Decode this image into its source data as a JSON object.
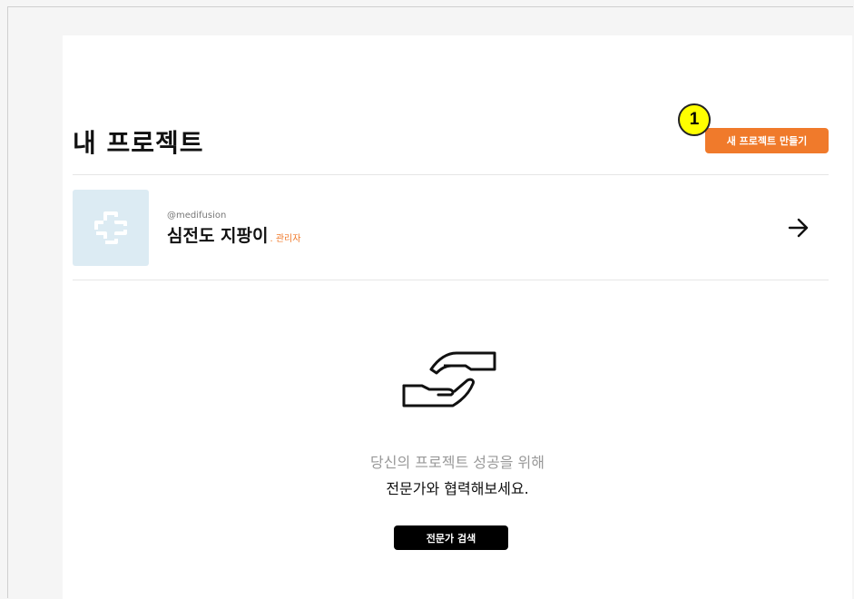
{
  "header": {
    "title": "내 프로젝트",
    "new_project_label": "새 프로젝트 만들기",
    "step_marker": "1"
  },
  "projects": [
    {
      "handle": "@medifusion",
      "name": "심전도 지팡이",
      "role": ". 관리자",
      "icon": "medical-cross-icon",
      "action_icon": "arrow-right-icon"
    }
  ],
  "empty_state": {
    "icon": "handshake-icon",
    "line1": "당신의 프로젝트 성공을 위해",
    "line2": "전문가와 협력해보세요.",
    "button_label": "전문가 검색"
  },
  "colors": {
    "accent": "#f07a2b",
    "thumb_bg": "#dcebf3",
    "badge": "#ffff00"
  }
}
